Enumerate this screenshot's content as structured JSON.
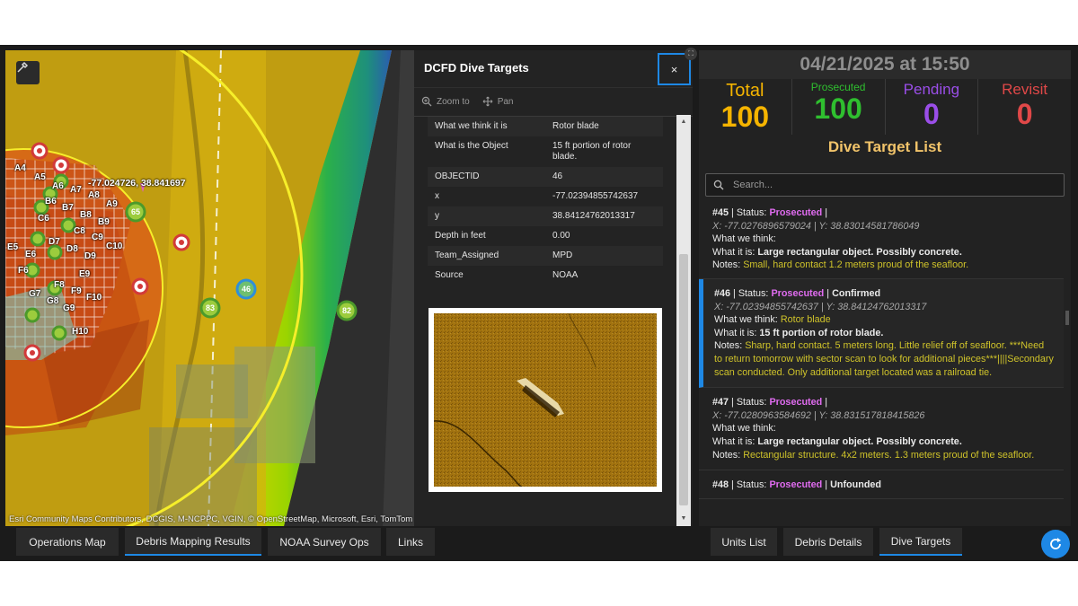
{
  "map": {
    "coord_label": "-77.024726, 38.841697",
    "attribution": "Esri Community Maps Contributors, DCGIS, M-NCPPC, VGIN, © OpenStreetMap, Microsoft, Esri, TomTom",
    "grid_labels": [
      "A4",
      "A5",
      "A6",
      "A7",
      "A8",
      "A9",
      "B6",
      "B7",
      "B8",
      "B9",
      "C6",
      "C8",
      "C9",
      "C10",
      "D7",
      "D8",
      "D9",
      "E5",
      "E6",
      "E9",
      "F6",
      "F8",
      "F9",
      "F10",
      "G7",
      "G8",
      "G9",
      "H10"
    ],
    "markers": [
      {
        "label": "65"
      },
      {
        "label": "46"
      },
      {
        "label": "83"
      },
      {
        "label": "82"
      }
    ]
  },
  "popup": {
    "title": "DCFD Dive Targets",
    "close_label": "×",
    "actions": [
      {
        "label": "Zoom to",
        "icon": "zoom-in-icon"
      },
      {
        "label": "Pan",
        "icon": "pan-icon"
      }
    ],
    "fields": [
      {
        "key": "What we think it is",
        "value": "Rotor blade"
      },
      {
        "key": "What is the Object",
        "value": "15 ft portion of rotor blade."
      },
      {
        "key": "OBJECTID",
        "value": "46"
      },
      {
        "key": "x",
        "value": "-77.02394855742637"
      },
      {
        "key": "y",
        "value": "38.84124762013317"
      },
      {
        "key": "Depth in feet",
        "value": "0.00"
      },
      {
        "key": "Team_Assigned",
        "value": "MPD"
      },
      {
        "key": "Source",
        "value": "NOAA"
      }
    ]
  },
  "dashboard": {
    "datetime": "04/21/2025 at 15:50",
    "stats": [
      {
        "label": "Total",
        "value": "100",
        "color": "#f5b400"
      },
      {
        "label": "Prosecuted",
        "value": "100",
        "color": "#2fbf2f"
      },
      {
        "label": "Pending",
        "value": "0",
        "color": "#9a4ee8"
      },
      {
        "label": "Revisit",
        "value": "0",
        "color": "#e04848"
      }
    ],
    "list_title": "Dive Target List",
    "search_placeholder": "Search...",
    "targets": [
      {
        "num": "#45",
        "status": "Prosecuted",
        "result": "",
        "coords": "X: -77.0276896579024 | Y: 38.83014581786049",
        "think": "",
        "is": "Large rectangular object. Possibly concrete.",
        "notes": "Small, hard contact 1.2 meters proud of the seafloor."
      },
      {
        "num": "#46",
        "status": "Prosecuted",
        "result": "Confirmed",
        "coords": "X: -77.02394855742637 | Y: 38.84124762013317",
        "think": "Rotor blade",
        "is": "15 ft portion of rotor blade.",
        "notes": "Sharp, hard contact. 5 meters long. Little relief off of seafloor. ***Need to return tomorrow with sector scan to look for additional pieces***||||Secondary scan conducted. Only additional target located was a railroad tie."
      },
      {
        "num": "#47",
        "status": "Prosecuted",
        "result": "",
        "coords": "X: -77.0280963584692 | Y: 38.831517818415826",
        "think": "",
        "is": "Large rectangular object. Possibly concrete.",
        "notes": "Rectangular structure. 4x2 meters. 1.3 meters proud of the seafloor."
      },
      {
        "num": "#48",
        "status": "Prosecuted",
        "result": "Unfounded",
        "coords": "",
        "think": "",
        "is": "",
        "notes": ""
      }
    ],
    "labels": {
      "status": "Status:",
      "sep": "|",
      "think": "What we think:",
      "is": "What it is:",
      "notes": "Notes:"
    }
  },
  "tabs_left": [
    {
      "label": "Operations Map",
      "active": false
    },
    {
      "label": "Debris Mapping Results",
      "active": true
    },
    {
      "label": "NOAA Survey Ops",
      "active": false
    },
    {
      "label": "Links",
      "active": false
    }
  ],
  "tabs_right": [
    {
      "label": "Units List",
      "active": false
    },
    {
      "label": "Debris Details",
      "active": false
    },
    {
      "label": "Dive Targets",
      "active": true
    }
  ],
  "colors": {
    "accent": "#1e88e5",
    "note_yellow": "#cfc32a",
    "prosecuted": "#e06cf0",
    "title_gold": "#f2c46a"
  }
}
